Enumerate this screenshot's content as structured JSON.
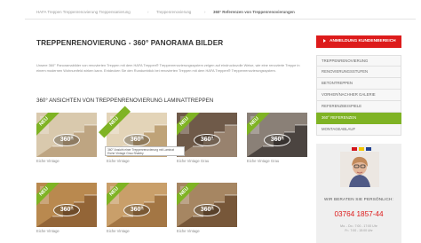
{
  "breadcrumb": {
    "items": [
      "HAFA Treppen Treppenrenovierung Treppensanierung",
      "Treppenrenovierung",
      "360° Referenzen von Treppenrenovierungen"
    ],
    "separator": "›"
  },
  "page": {
    "title": "TREPPENRENOVIERUNG - 360° PANORAMA BILDER",
    "intro": "Unsere 360° Panoramabilder von renovierten Treppen mit dem HAFA Treppen® Treppenrenovierungssystem zeigen auf eindrucksvolle Weise, wie eine renovierte Treppe in einem modernen Wohnumfeld wirken kann. Entdecken Sie den Rundumblick bei renovierten Treppen mit dem HAFA Treppen® Treppenrenovierungssystem.",
    "section_heading": "360° ANSICHTEN VON TREPPENRENOVIERUNG LAMINATTREPPEN"
  },
  "gallery": {
    "badge": "NEU",
    "pano_label": "360°",
    "tooltip": "360° Ansicht einer Treppenrenovierung mit Laminat Eiche Vintage Grau Shabby",
    "items": [
      {
        "caption": "Eiche Vintage",
        "tone": "#d9c9ad",
        "accent": "#b89f7a"
      },
      {
        "caption": "Eiche Vintage",
        "tone": "#e3d4b8",
        "accent": "#b99a6c"
      },
      {
        "caption": "Eiche Vintage Grau",
        "tone": "#6f5a49",
        "accent": "#a08a74"
      },
      {
        "caption": "Eiche Vintage Grau",
        "tone": "#8a8077",
        "accent": "#3f3a36"
      },
      {
        "caption": "Eiche Vintage",
        "tone": "#b9894f",
        "accent": "#8c5f33"
      },
      {
        "caption": "Eiche Vintage",
        "tone": "#c99f6a",
        "accent": "#9c6f3d"
      },
      {
        "caption": "Eiche Vintage",
        "tone": "#a68662",
        "accent": "#6f4f33"
      }
    ]
  },
  "sidebar": {
    "cta": "ANMELDUNG KUNDENBEREICH",
    "nav": [
      {
        "label": "TREPPENRENOVIERUNG",
        "active": false
      },
      {
        "label": "RENOVIERUNGSSTUFEN",
        "active": false
      },
      {
        "label": "BETONTREPPEN",
        "active": false
      },
      {
        "label": "VORHER/NACHHER GALERIE",
        "active": false
      },
      {
        "label": "REFERENZBEISPIELE",
        "active": false
      },
      {
        "label": "360° REFERENZEN",
        "active": true
      },
      {
        "label": "MONTAGEABLAUF",
        "active": false
      }
    ],
    "flags": [
      "#d4151b",
      "#f2c500",
      "#1f3f8f"
    ],
    "contact_heading": "WIR BERATEN SIE PERSÖNLICH:",
    "phone": "03764 1857-44",
    "hours": [
      "Mo. - Do.: 7:00 - 17:00 Uhr",
      "Fr.: 7:00 - 15:00 Uhr"
    ]
  },
  "colors": {
    "accent_green": "#7fb324",
    "accent_red": "#dd1b1b"
  }
}
